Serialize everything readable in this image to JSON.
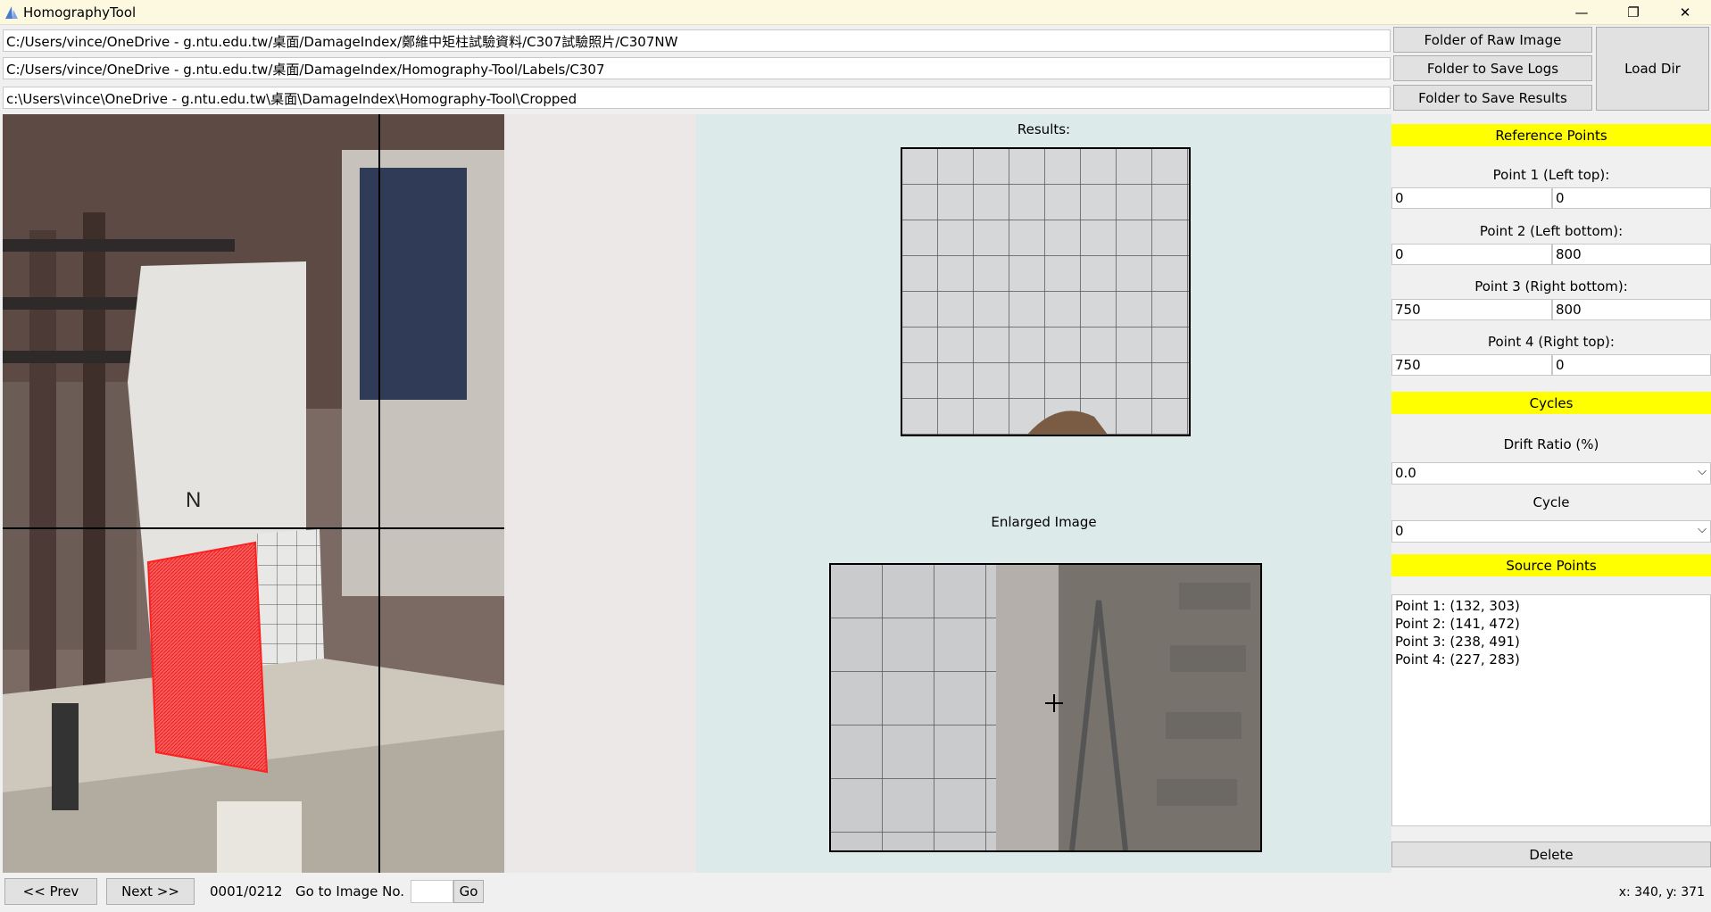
{
  "window": {
    "title": "HomographyTool",
    "minimize_icon": "minimize-icon",
    "restore_icon": "restore-icon",
    "close_icon": "close-icon"
  },
  "paths": {
    "raw_image": "C:/Users/vince/OneDrive - g.ntu.edu.tw/桌面/DamageIndex/鄭維中矩柱試驗資料/C307試驗照片/C307NW",
    "logs": "C:/Users/vince/OneDrive - g.ntu.edu.tw/桌面/DamageIndex/Homography-Tool/Labels/C307",
    "results": "c:\\Users\\vince\\OneDrive - g.ntu.edu.tw\\桌面\\DamageIndex\\Homography-Tool\\Cropped"
  },
  "buttons": {
    "raw_image": "Folder of Raw Image",
    "save_logs": "Folder to Save Logs",
    "save_results": "Folder to Save Results",
    "load_dir": "Load Dir",
    "delete": "Delete",
    "prev": "<< Prev",
    "next": "Next >>",
    "go": "Go"
  },
  "viewer": {
    "results_label": "Results:",
    "enlarged_label": "Enlarged Image"
  },
  "reference": {
    "header": "Reference Points",
    "points": [
      {
        "label": "Point 1 (Left top):",
        "x": "0",
        "y": "0"
      },
      {
        "label": "Point 2 (Left bottom):",
        "x": "0",
        "y": "800"
      },
      {
        "label": "Point 3 (Right bottom):",
        "x": "750",
        "y": "800"
      },
      {
        "label": "Point 4 (Right top):",
        "x": "750",
        "y": "0"
      }
    ]
  },
  "cycles": {
    "header": "Cycles",
    "drift_label": "Drift Ratio (%)",
    "drift_value": "0.0",
    "cycle_label": "Cycle",
    "cycle_value": "0"
  },
  "source": {
    "header": "Source Points",
    "points": [
      "Point 1: (132, 303)",
      "Point 2: (141, 472)",
      "Point 3: (238, 491)",
      "Point 4: (227, 283)"
    ]
  },
  "bottom": {
    "counter": "0001/0212",
    "goto_label": "Go to Image No.",
    "goto_value": "",
    "coords": "x: 340, y: 371"
  },
  "colors": {
    "highlight": "#ffff00",
    "selection": "#ff3333",
    "panel": "#ddeaea"
  }
}
